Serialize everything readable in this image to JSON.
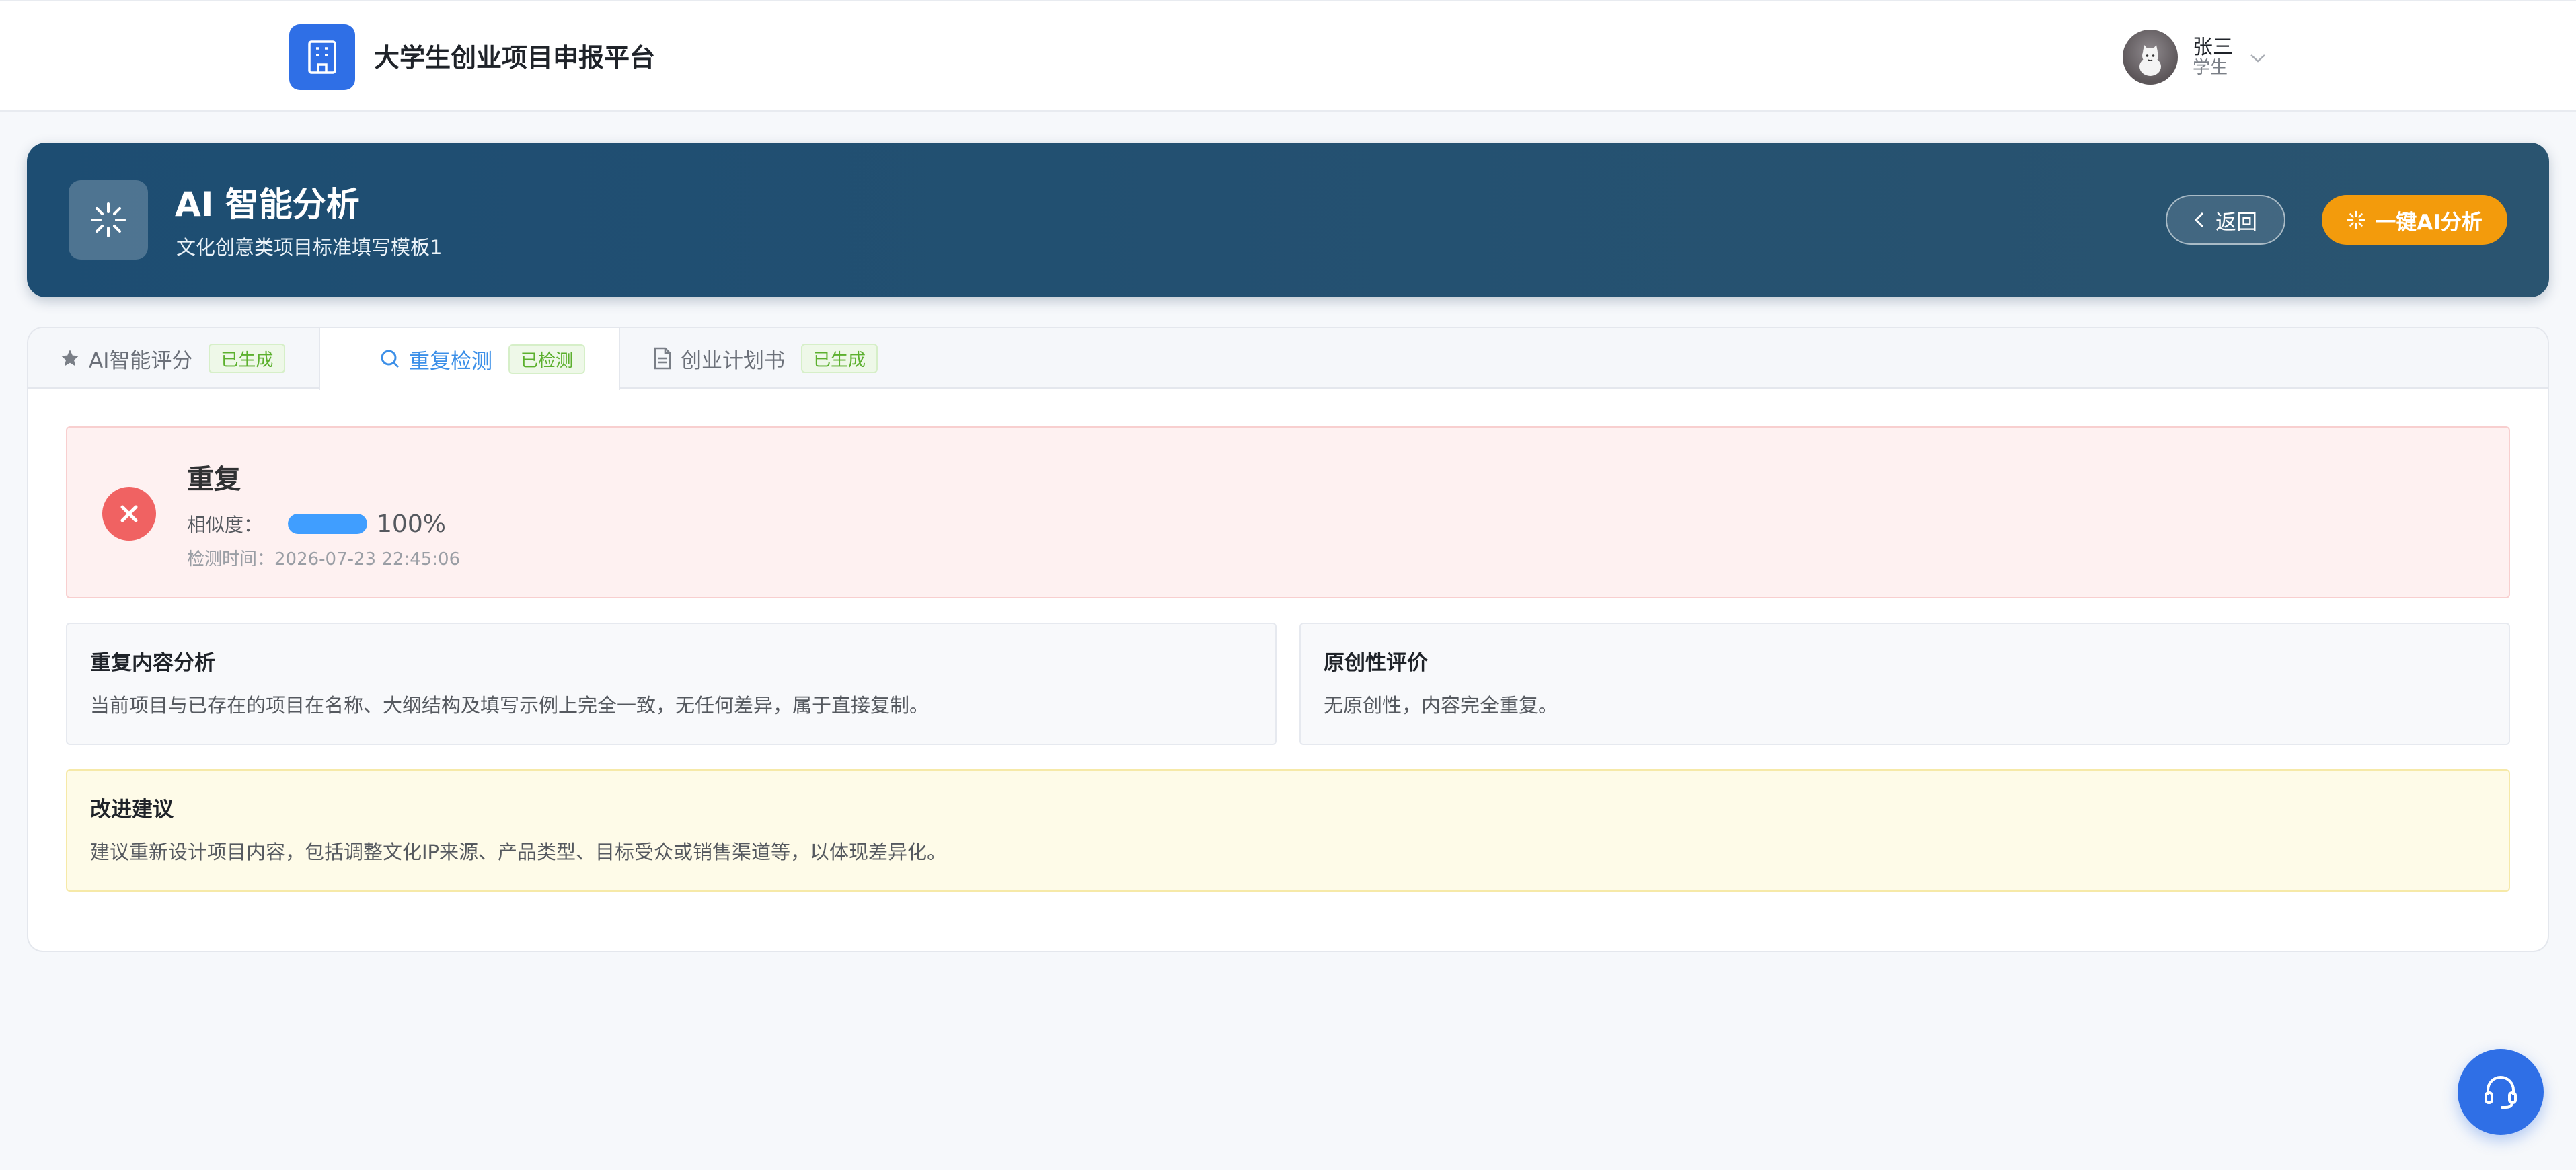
{
  "header": {
    "app_title": "大学生创业项目申报平台",
    "logo_icon": "building-icon",
    "user": {
      "name": "张三",
      "role": "学生"
    }
  },
  "banner": {
    "icon": "sparkle-loading-icon",
    "title": "AI 智能分析",
    "subtitle": "文化创意类项目标准填写模板1",
    "back_label": "返回",
    "ai_button_label": "一键AI分析"
  },
  "tabs": [
    {
      "label": "AI智能评分",
      "badge": "已生成",
      "icon": "star-icon",
      "active": false
    },
    {
      "label": "重复检测",
      "badge": "已检测",
      "icon": "search-icon",
      "active": true
    },
    {
      "label": "创业计划书",
      "badge": "已生成",
      "icon": "document-icon",
      "active": false
    }
  ],
  "result": {
    "status": "重复",
    "similarity_label": "相似度：",
    "similarity_value": "100%",
    "similarity_fraction": 1.0,
    "check_time": "检测时间：2026-07-23 22:45:06"
  },
  "analysis": {
    "title": "重复内容分析",
    "text": "当前项目与已存在的项目在名称、大纲结构及填写示例上完全一致，无任何差异，属于直接复制。"
  },
  "originality": {
    "title": "原创性评价",
    "text": "无原创性，内容完全重复。"
  },
  "suggestion": {
    "title": "改进建议",
    "text": "建议重新设计项目内容，包括调整文化IP来源、产品类型、目标受众或销售渠道等，以体现差异化。"
  },
  "colors": {
    "primary": "#2f6fe6",
    "banner": "#1d4d72",
    "accent_orange": "#f39b0c",
    "error": "#f06262",
    "success": "#5cb02e",
    "progress": "#409eff"
  }
}
